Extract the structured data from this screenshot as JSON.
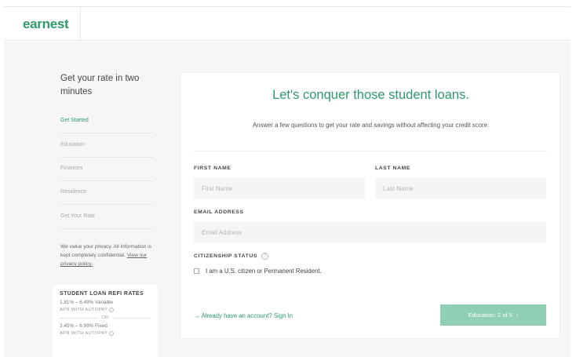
{
  "header": {
    "logo": "earnest"
  },
  "sidebar": {
    "title": "Get your rate in two minutes",
    "steps": [
      {
        "label": "Get Started"
      },
      {
        "label": "Education"
      },
      {
        "label": "Finances"
      },
      {
        "label": "Residence"
      },
      {
        "label": "Get Your Rate"
      }
    ],
    "privacy_text": "We value your privacy. All information is kept completely confidential.",
    "privacy_link": "View our privacy policy."
  },
  "rates": {
    "title": "STUDENT LOAN REFI RATES",
    "variable": "1.81% – 6.49% Variable",
    "autopay_1": "APR WITH AUTOPAY",
    "or": "OR",
    "fixed": "3.45% – 6.99% Fixed",
    "autopay_2": "APR WITH AUTOPAY"
  },
  "main": {
    "headline": "Let's conquer those student loans.",
    "subline": "Answer a few questions to get your rate and savings without affecting your credit score.",
    "first_name_label": "FIRST NAME",
    "first_name_placeholder": "First Name",
    "last_name_label": "LAST NAME",
    "last_name_placeholder": "Last Name",
    "email_label": "EMAIL ADDRESS",
    "email_placeholder": "Email Address",
    "citizenship_label": "CITIZENSHIP STATUS",
    "citizenship_checkbox": "I am a U.S. citizen or Permanent Resident.",
    "signin_link": "→ Already have an account? Sign In",
    "next_button": "Education: 2 of 5",
    "next_icon": "chevron-right-icon"
  },
  "colors": {
    "brand": "#2f9a6a",
    "button": "#8fd0b4"
  }
}
